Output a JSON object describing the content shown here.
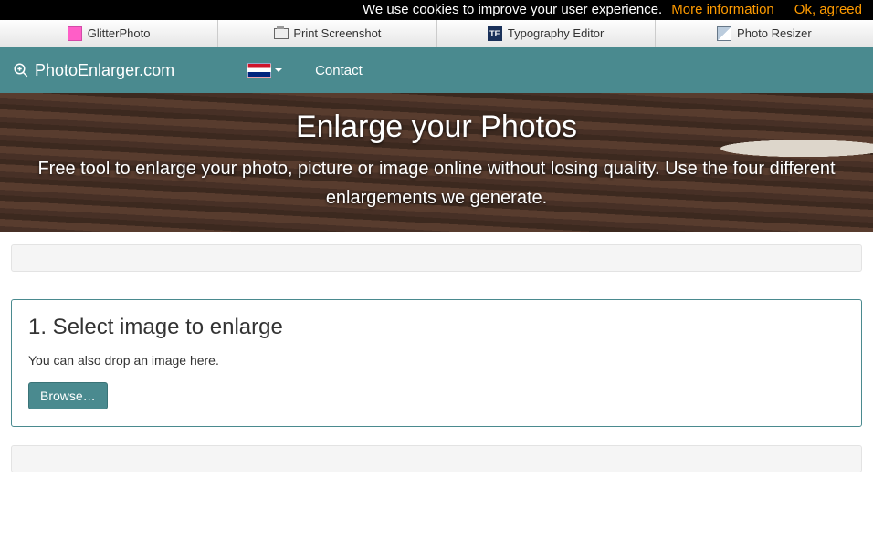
{
  "cookie": {
    "message": "We use cookies to improve your user experience.",
    "more": "More information",
    "ok": "Ok, agreed"
  },
  "tabs": {
    "glitter": "GlitterPhoto",
    "print": "Print Screenshot",
    "typo_badge": "TE",
    "typo": "Typography Editor",
    "resize": "Photo Resizer"
  },
  "nav": {
    "brand": "PhotoEnlarger.com",
    "contact": "Contact"
  },
  "hero": {
    "title": "Enlarge your Photos",
    "subtitle": "Free tool to enlarge your photo, picture or image online without losing quality. Use the four different enlargements we generate."
  },
  "step1": {
    "title": "1. Select image to enlarge",
    "hint": "You can also drop an image here.",
    "browse": "Browse…"
  }
}
